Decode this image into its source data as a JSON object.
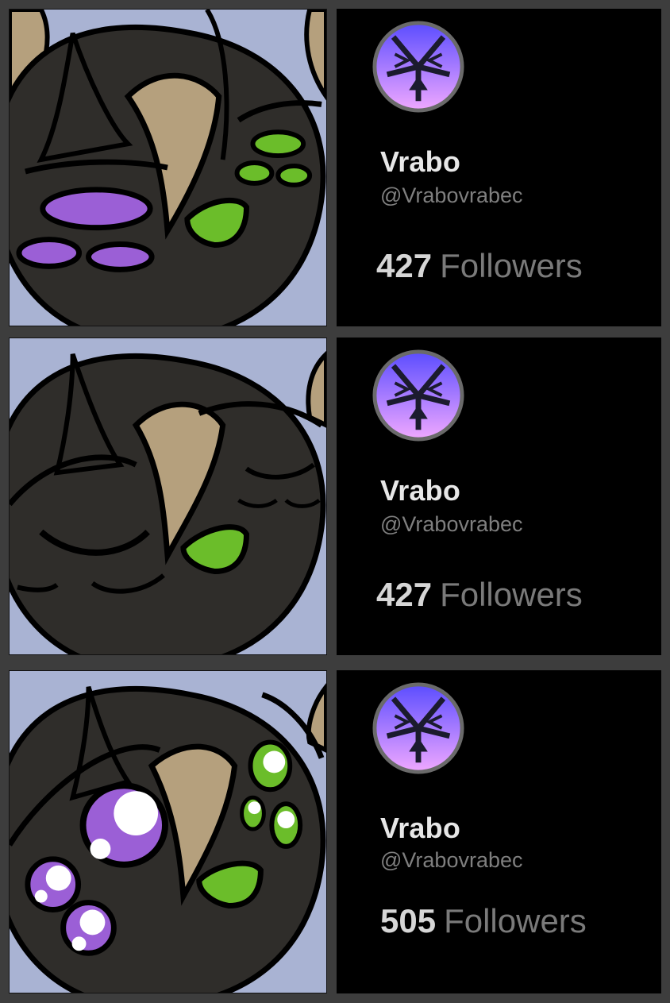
{
  "panels": [
    {
      "name": "Vrabo",
      "handle": "@Vrabovrabec",
      "follower_count": "427",
      "follower_label": "Followers",
      "expression": "squinting"
    },
    {
      "name": "Vrabo",
      "handle": "@Vrabovrabec",
      "follower_count": "427",
      "follower_label": "Followers",
      "expression": "eyes-closed"
    },
    {
      "name": "Vrabo",
      "handle": "@Vrabovrabec",
      "follower_count": "505",
      "follower_label": "Followers",
      "expression": "wide-eyed"
    }
  ],
  "colors": {
    "background": "#3d3d3d",
    "card": "#000000",
    "face": "#2f2d2a",
    "hair": "#b5a07d",
    "sky": "#a9b3d3",
    "left_eyes": "#9b5fd6",
    "right_eyes": "#6bbd2a",
    "avatar_top": "#5b4dff",
    "avatar_bottom": "#f0a8ff"
  },
  "icons": {
    "avatar": "vrabo-emblem-icon"
  }
}
